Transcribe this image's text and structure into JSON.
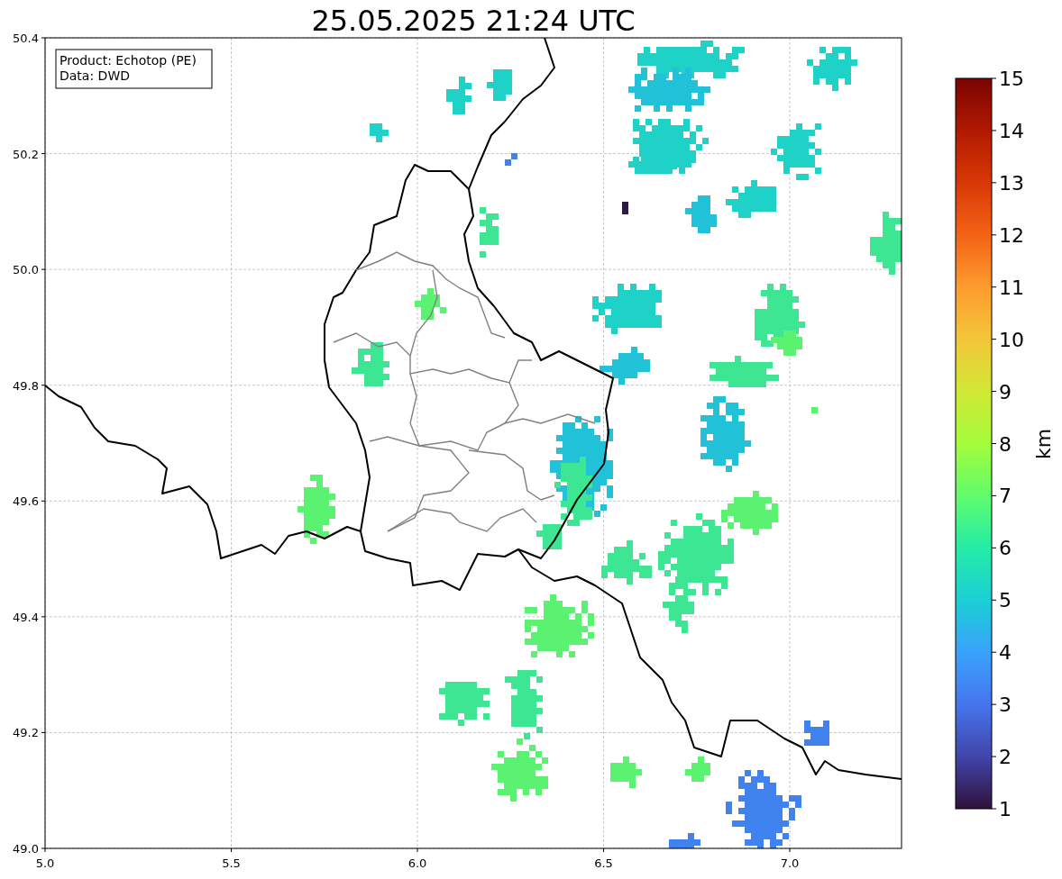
{
  "title": "25.05.2025 21:24 UTC",
  "info_box": {
    "lines": [
      "Product: Echotop (PE)",
      "Data: DWD"
    ]
  },
  "x_axis": {
    "ticks": [
      "5.0",
      "5.5",
      "6.0",
      "6.5",
      "7.0"
    ]
  },
  "y_axis": {
    "ticks": [
      "50.4",
      "50.2",
      "50.0",
      "49.8",
      "49.6",
      "49.4",
      "49.2",
      "49.0"
    ]
  },
  "colorbar": {
    "label": "km",
    "ticks": [
      "15",
      "14",
      "13",
      "12",
      "11",
      "10",
      "9",
      "8",
      "7",
      "6",
      "5",
      "4",
      "3",
      "2",
      "1"
    ]
  }
}
